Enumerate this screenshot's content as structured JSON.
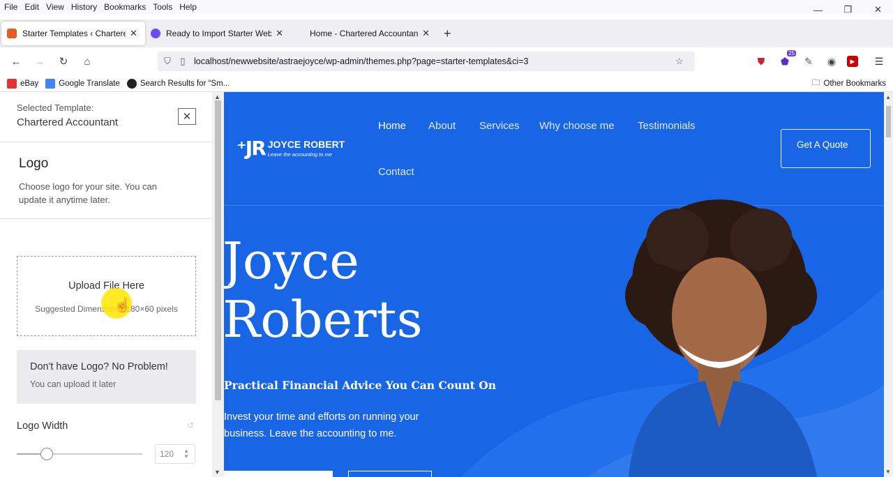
{
  "menu": [
    "File",
    "Edit",
    "View",
    "History",
    "Bookmarks",
    "Tools",
    "Help"
  ],
  "tabs": [
    {
      "title": "Starter Templates ‹ Chartered Ac",
      "active": true,
      "color": "#e25d2a"
    },
    {
      "title": "Ready to Import Starter Website",
      "active": false,
      "color": "#6c4cf2"
    },
    {
      "title": "Home - Chartered Accountant",
      "active": false,
      "color": "#f0f0f4"
    }
  ],
  "url": "localhost/newwebsite/astraejoyce/wp-admin/themes.php?page=starter-templates&ci=3",
  "extension_badge": "25",
  "bookmarks": [
    {
      "label": "eBay",
      "color": "#e53238"
    },
    {
      "label": "Google Translate",
      "color": "#4285f4"
    },
    {
      "label": "Search Results for “Sm...",
      "color": "#222"
    }
  ],
  "other_bookmarks": "Other Bookmarks",
  "panel": {
    "selected_label": "Selected Template:",
    "selected_value": "Chartered Accountant",
    "logo_heading": "Logo",
    "logo_desc": "Choose logo for your site. You can update it anytime later.",
    "upload_title": "Upload File Here",
    "upload_hint": "Suggested Dimensions: 180×60 pixels",
    "nologo_title": "Don't have Logo? No Problem!",
    "nologo_desc": "You can upload it later",
    "logo_width_label": "Logo Width",
    "logo_width_value": "120",
    "logo_width_fraction": 0.24
  },
  "site": {
    "brand_mark": "⁺JR",
    "brand_name": "JOYCE ROBERT",
    "brand_tagline": "Leave the accounting to me",
    "nav": [
      "Home",
      "About",
      "Services",
      "Why choose me",
      "Testimonials",
      "Contact"
    ],
    "cta": "Get A Quote",
    "hero_line1": "Joyce",
    "hero_line2": "Roberts",
    "subheading": "Practical Financial Advice You Can Count On",
    "paragraph": "Invest your time and efforts on running your business. Leave the accounting to me.",
    "accent": "#1866e6"
  }
}
